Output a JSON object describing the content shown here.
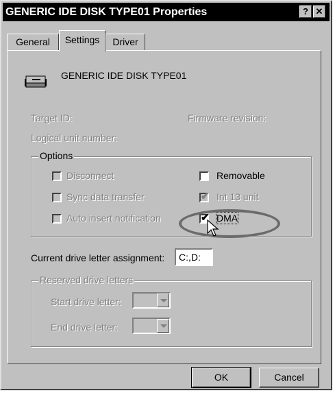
{
  "window": {
    "title": "GENERIC IDE  DISK TYPE01 Properties",
    "help_glyph": "?",
    "close_glyph": "✕"
  },
  "tabs": [
    {
      "label": "General"
    },
    {
      "label": "Settings"
    },
    {
      "label": "Driver"
    }
  ],
  "device": {
    "name": "GENERIC IDE  DISK TYPE01",
    "icon": "drive-icon"
  },
  "info": {
    "target_id_label": "Target ID:",
    "firmware_label": "Firmware revision:",
    "lun_label": "Logical unit number:"
  },
  "options": {
    "legend": "Options",
    "items": [
      {
        "label": "Disconnect",
        "checked": false,
        "enabled": false
      },
      {
        "label": "Sync data transfer",
        "checked": false,
        "enabled": false
      },
      {
        "label": "Auto insert notification",
        "checked": false,
        "enabled": false
      },
      {
        "label": "Removable",
        "checked": false,
        "enabled": true
      },
      {
        "label": "Int 13 unit",
        "checked": true,
        "enabled": false
      },
      {
        "label": "DMA",
        "checked": true,
        "enabled": true
      }
    ]
  },
  "drive_letter": {
    "label": "Current drive letter assignment:",
    "value": "C:,D:"
  },
  "reserved": {
    "legend": "Reserved drive letters",
    "start_label": "Start drive letter:",
    "end_label": "End drive letter:"
  },
  "buttons": {
    "ok": "OK",
    "cancel": "Cancel"
  },
  "colors": {
    "face": "#c0c0c0",
    "titlebar": "#000000",
    "disabled_text": "#808080",
    "highlight_ring": "#6b6b6b"
  }
}
